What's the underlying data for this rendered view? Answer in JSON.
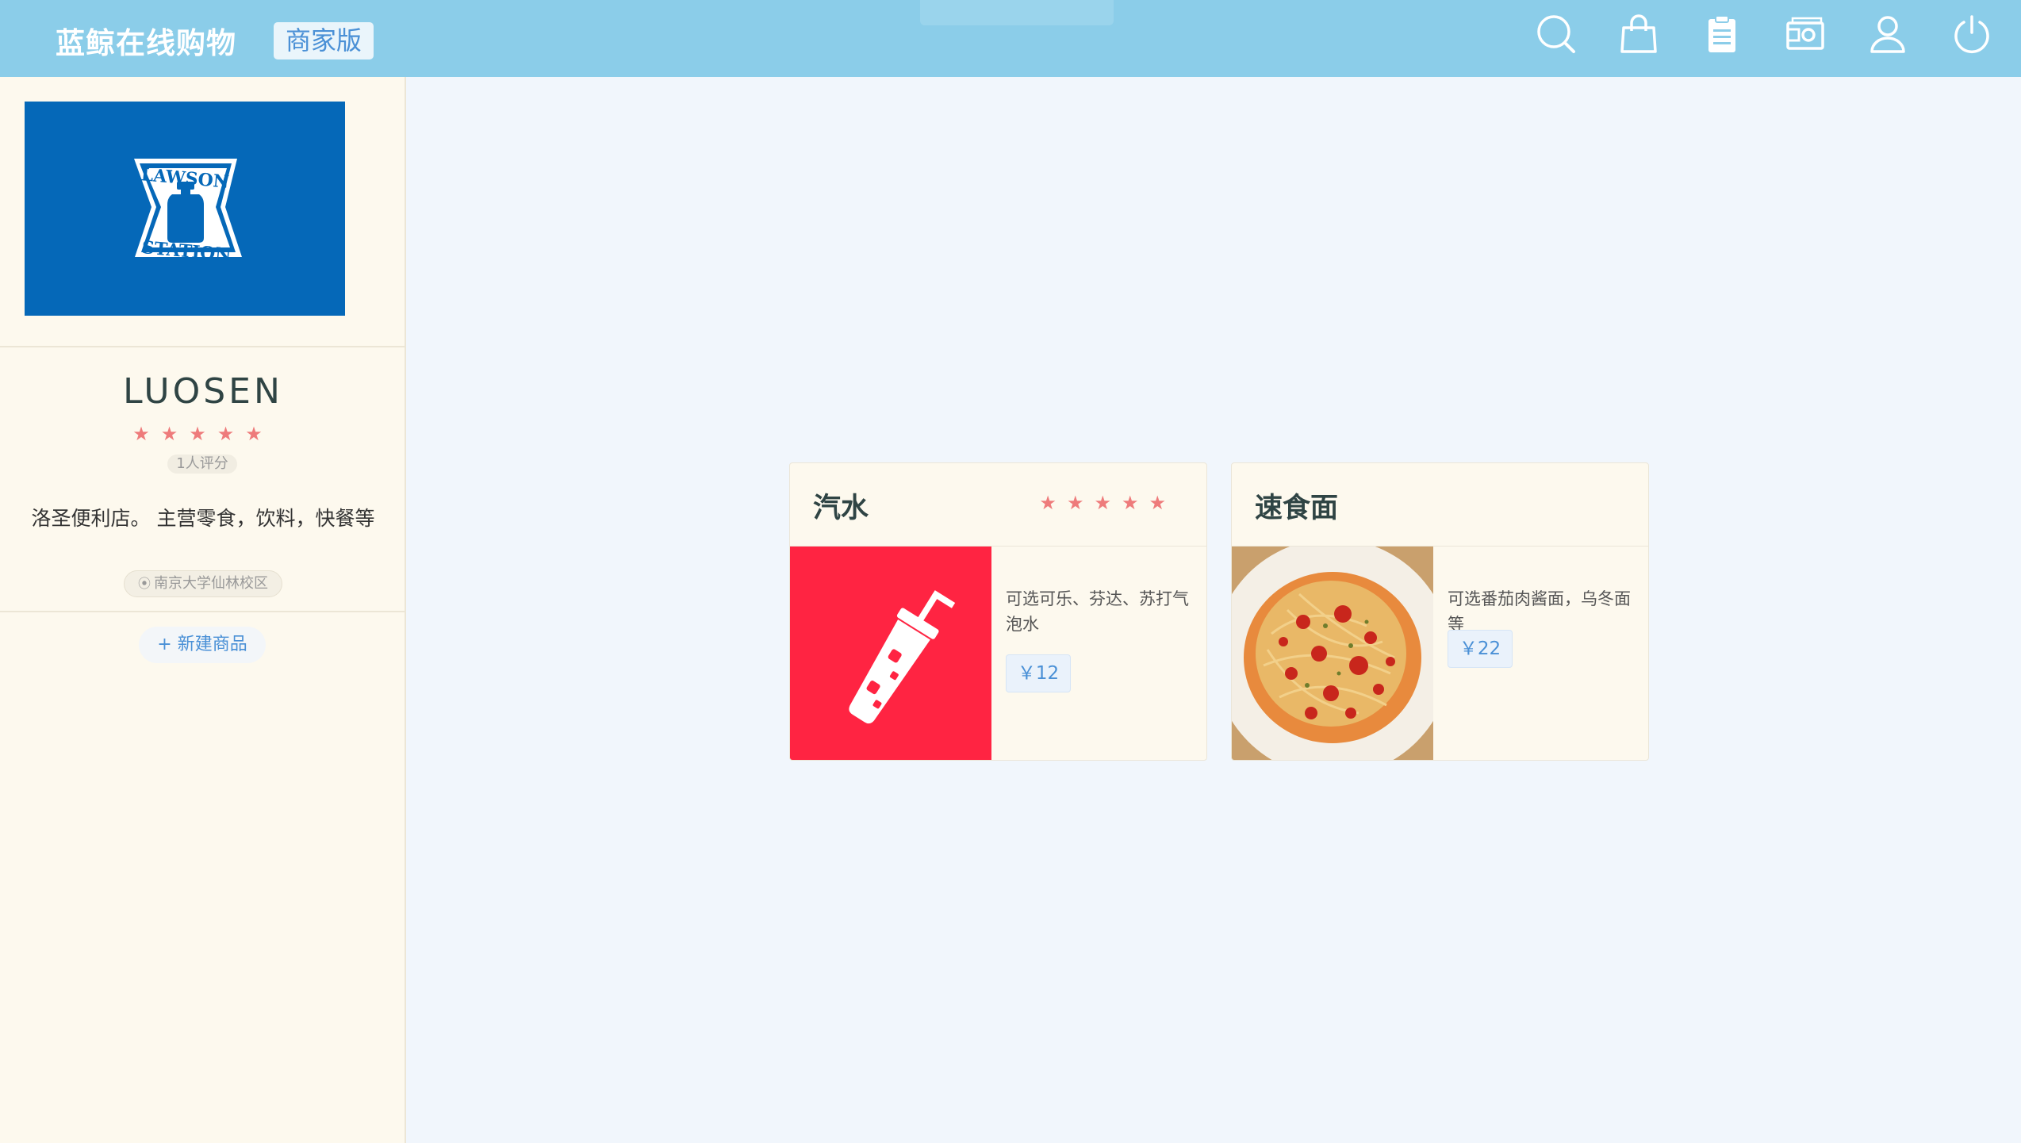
{
  "header": {
    "app_title": "蓝鲸在线购物",
    "edition_label": "商家版",
    "icons": [
      "search-icon",
      "shopping-bag-icon",
      "clipboard-icon",
      "wallet-icon",
      "user-icon",
      "power-icon"
    ]
  },
  "store": {
    "logo_text_top": "LAWSON",
    "logo_text_bottom": "STATION",
    "name": "LUOSEN",
    "stars": "★★★★★",
    "rating_count": "1人评分",
    "description": "洛圣便利店。 主营零食，饮料，快餐等",
    "location": "南京大学仙林校区",
    "new_product_label": "+ 新建商品"
  },
  "products": [
    {
      "title": "汽水",
      "stars": "★★★★★",
      "description": "可选可乐、芬达、苏打气泡水",
      "price": "￥12",
      "image": "soda-drink-icon",
      "image_color": "#ff2442"
    },
    {
      "title": "速食面",
      "stars": "",
      "description": "可选番茄肉酱面，乌冬面等",
      "price": "￥22",
      "image": "spaghetti-photo"
    }
  ],
  "colors": {
    "topbar": "#8bcde9",
    "accent": "#4a90d6",
    "star": "#ee7b7b",
    "logo_bg": "#0568b8"
  }
}
